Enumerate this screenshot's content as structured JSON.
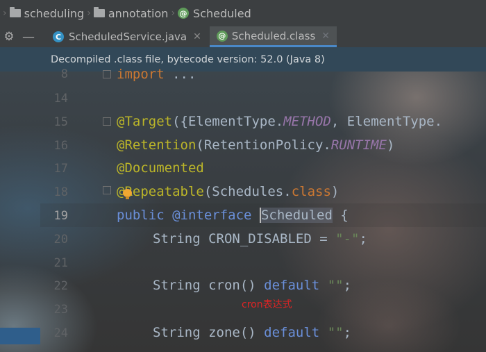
{
  "breadcrumb": {
    "items": [
      {
        "label": "scheduling",
        "icon": "folder-icon"
      },
      {
        "label": "annotation",
        "icon": "folder-icon"
      },
      {
        "label": "Scheduled",
        "icon": "annotation-icon"
      }
    ]
  },
  "tabs": [
    {
      "label": "ScheduledService.java",
      "icon": "class-icon",
      "icon_glyph": "C",
      "active": false
    },
    {
      "label": "Scheduled.class",
      "icon": "annotation-icon",
      "icon_glyph": "@",
      "active": true
    }
  ],
  "banner": {
    "text": "Decompiled .class file, bytecode version: 52.0 (Java 8)"
  },
  "editor": {
    "current_line": "19",
    "lines": [
      {
        "num": "8"
      },
      {
        "num": "14"
      },
      {
        "num": "15"
      },
      {
        "num": "16"
      },
      {
        "num": "17"
      },
      {
        "num": "18"
      },
      {
        "num": "19"
      },
      {
        "num": "20"
      },
      {
        "num": "21"
      },
      {
        "num": "22"
      },
      {
        "num": "23"
      },
      {
        "num": "24"
      }
    ],
    "code": {
      "l8": {
        "kw": "import",
        "rest": " ..."
      },
      "l15": {
        "ann": "@Target",
        "p1": "({ElementType.",
        "c1": "METHOD",
        "p2": ", ElementType."
      },
      "l16": {
        "ann": "@Retention",
        "p1": "(RetentionPolicy.",
        "c1": "RUNTIME",
        "p2": ")"
      },
      "l17": {
        "ann": "@Documented"
      },
      "l18": {
        "ann": "@Repeatable",
        "p1": "(Schedules.",
        "kw": "class",
        "p2": ")"
      },
      "l19": {
        "kw1": "public",
        "sp": " ",
        "ann": "@interface",
        "name": "Scheduled",
        "rest": " {"
      },
      "l20": {
        "p1": "String CRON_DISABLED = ",
        "str": "\"-\"",
        "p2": ";"
      },
      "l22": {
        "p1": "String cron() ",
        "kw": "default",
        "sp": " ",
        "str": "\"\"",
        "p2": ";"
      },
      "l24": {
        "p1": "String zone() ",
        "kw": "default",
        "sp": " ",
        "str": "\"\"",
        "p2": ";"
      }
    },
    "note": "cron表达式"
  },
  "colors": {
    "keyword": "#cc7832",
    "annotation": "#bbb529",
    "string": "#6a8759",
    "text": "#a9b7c6",
    "note": "#e02424",
    "tab_underline": "#4a88c7"
  }
}
